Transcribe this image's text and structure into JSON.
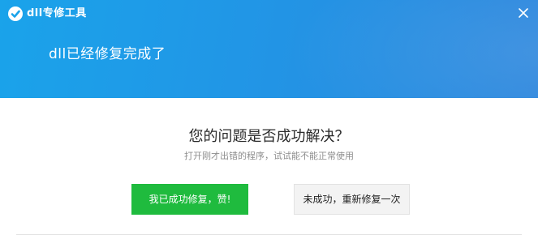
{
  "window": {
    "app_title": "dll专修工具",
    "logo_icon": "logo-icon",
    "close_icon": "close-icon"
  },
  "header": {
    "status_title": "dll已经修复完成了"
  },
  "main": {
    "question": "您的问题是否成功解决？",
    "hint": "打开刚才出错的程序，试试能不能正常使用",
    "success_button_label": "我已成功修复，赞!",
    "fail_button_label": "未成功，重新修复一次"
  },
  "colors": {
    "header_gradient_start": "#1aa3ea",
    "header_gradient_end": "#2c86dd",
    "success_green": "#1fbb3e",
    "secondary_button_bg": "#f3f3f3"
  }
}
